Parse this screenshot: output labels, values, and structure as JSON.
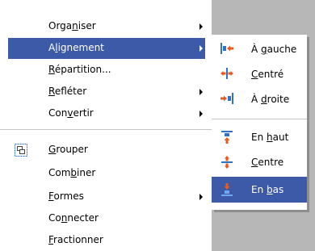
{
  "main_menu": {
    "items": [
      {
        "pre": "Orga",
        "ul": "n",
        "post": "iser",
        "has_submenu": true
      },
      {
        "pre": "A",
        "ul": "l",
        "post": "ignement",
        "has_submenu": true,
        "selected": true
      },
      {
        "pre": "",
        "ul": "R",
        "post": "épartition...",
        "has_submenu": false
      },
      {
        "pre": "",
        "ul": "R",
        "post": "efléter",
        "has_submenu": true
      },
      {
        "pre": "Con",
        "ul": "v",
        "post": "ertir",
        "has_submenu": true
      },
      {
        "pre": "",
        "ul": "G",
        "post": "rouper",
        "has_submenu": false,
        "icon": "group-icon"
      },
      {
        "pre": "Com",
        "ul": "b",
        "post": "iner",
        "has_submenu": false
      },
      {
        "pre": "",
        "ul": "F",
        "post": "ormes",
        "has_submenu": true
      },
      {
        "pre": "Co",
        "ul": "n",
        "post": "necter",
        "has_submenu": false
      },
      {
        "pre": "",
        "ul": "F",
        "post": "ractionner",
        "has_submenu": false
      }
    ]
  },
  "alignment_submenu": {
    "items": [
      {
        "pre": "À ",
        "ul": "g",
        "post": "auche",
        "icon": "align-left-icon"
      },
      {
        "pre": "",
        "ul": "C",
        "post": "entré",
        "icon": "align-center-horizontal-icon"
      },
      {
        "pre": "À ",
        "ul": "d",
        "post": "roite",
        "icon": "align-right-icon"
      },
      {
        "pre": "En ",
        "ul": "h",
        "post": "aut",
        "icon": "align-top-icon"
      },
      {
        "pre": "",
        "ul": "C",
        "post": "entre",
        "icon": "align-center-vertical-icon"
      },
      {
        "pre": "En ",
        "ul": "b",
        "post": "as",
        "icon": "align-bottom-icon",
        "selected": true
      }
    ]
  },
  "colors": {
    "selection": "#3d5aa8",
    "background_right": "#b7b7b7",
    "icon_blue": "#2e73c6",
    "icon_orange": "#e85a1e"
  }
}
